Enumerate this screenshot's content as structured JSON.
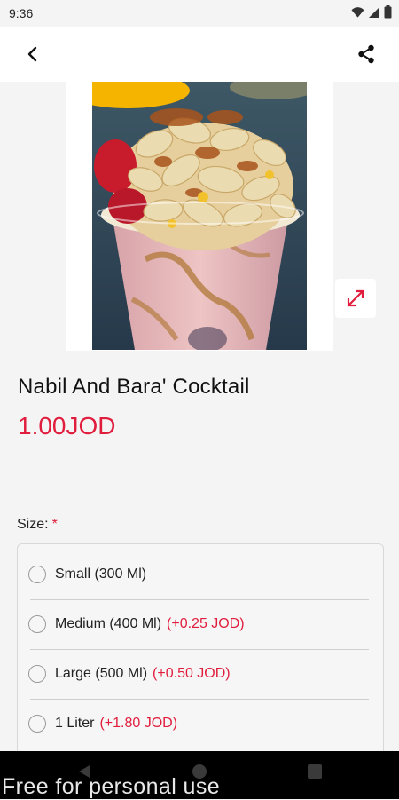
{
  "status_bar": {
    "time": "9:36"
  },
  "app_bar": {
    "back_icon": "arrow-back-icon",
    "share_icon": "share-icon"
  },
  "product": {
    "image_alt": "cocktail cup topped with nuts, caramel and cherries",
    "title": "Nabil And Bara' Cocktail",
    "price": "1.00JOD"
  },
  "size_section": {
    "label": "Size:",
    "required_mark": "*",
    "options": [
      {
        "label": "Small (300 Ml)",
        "extra": ""
      },
      {
        "label": "Medium (400 Ml)",
        "extra": "(+0.25 JOD)"
      },
      {
        "label": "Large (500 Ml)",
        "extra": "(+0.50 JOD)"
      },
      {
        "label": "1 Liter",
        "extra": "(+1.80 JOD)"
      }
    ]
  },
  "watermark": "Free for personal use",
  "colors": {
    "accent": "#e11d3d",
    "background": "#f4f4f4",
    "nav_bar": "#000000"
  }
}
